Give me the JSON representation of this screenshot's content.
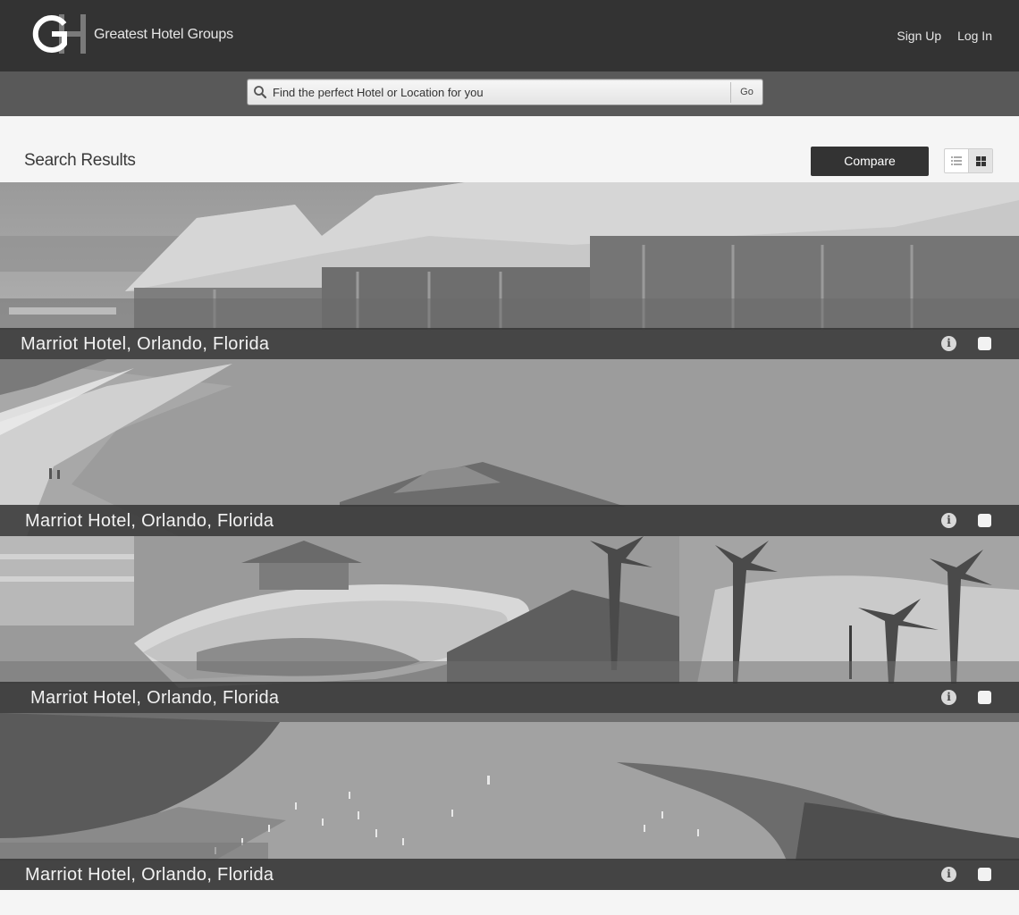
{
  "header": {
    "logo_letters": "GH",
    "brand": "Greatest Hotel Groups",
    "signup": "Sign Up",
    "login": "Log In"
  },
  "search": {
    "placeholder": "Find the perfect Hotel or Location for you",
    "go_label": "Go"
  },
  "results": {
    "title": "Search Results",
    "compare_label": "Compare",
    "view_modes": [
      "list",
      "grid"
    ],
    "selected_view": "grid",
    "items": [
      {
        "name": "Marriot Hotel, Orlando, Florida",
        "scene": "thatched-huts"
      },
      {
        "name": "Marriot Hotel, Orlando, Florida",
        "scene": "beach"
      },
      {
        "name": "Marriot Hotel, Orlando, Florida",
        "scene": "pool-palms"
      },
      {
        "name": "Marriot Hotel, Orlando, Florida",
        "scene": "harbor-aerial"
      }
    ]
  },
  "icons": {
    "search": "magnifier-icon",
    "info": "info-icon",
    "list_view": "list-view-icon",
    "grid_view": "grid-view-icon"
  },
  "colors": {
    "topbar": "#333333",
    "searchbar": "#595959",
    "page_bg": "#f5f5f5",
    "caption_bg": "#373737",
    "compare_bg": "#333333"
  }
}
